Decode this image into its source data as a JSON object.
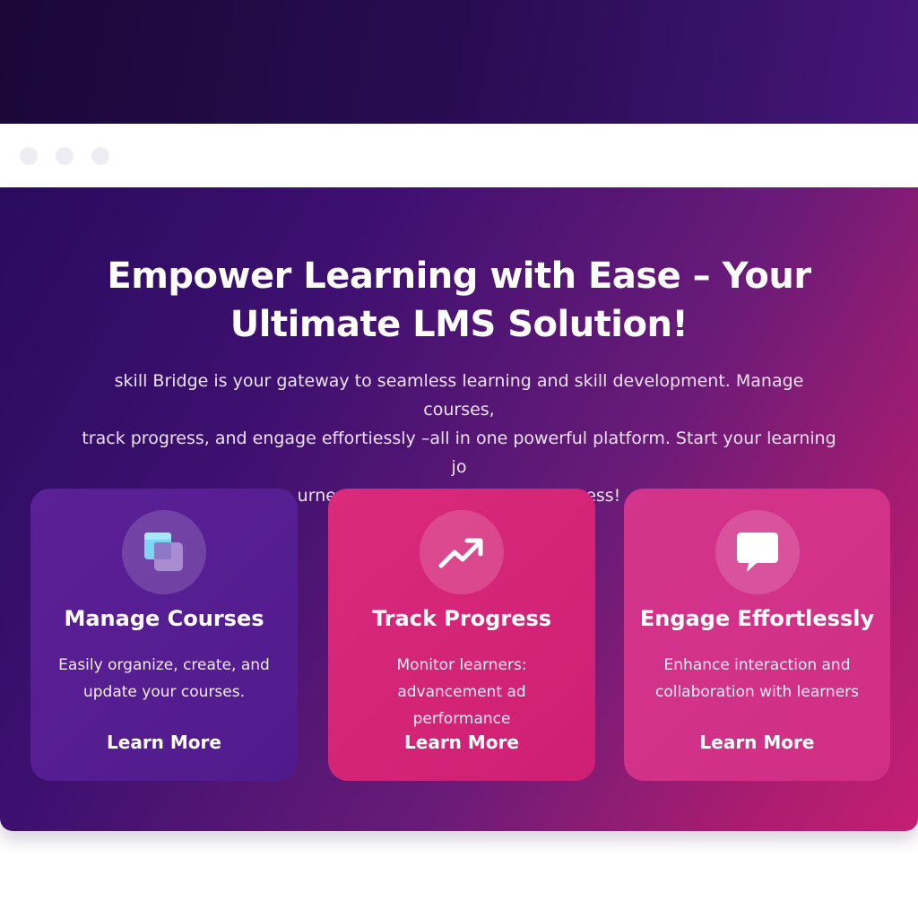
{
  "browser": {
    "window_controls": [
      "dot",
      "dot",
      "dot"
    ]
  },
  "hero": {
    "title_line1": "Empower Learning with Ease – Your",
    "title_line2": "Ultimate LMS Solution!",
    "description_line1": "skill Bridge is your gateway to seamless learning and skill development. Manage courses,",
    "description_line2": "track progress, and engage effortiessly –all in one powerful platform. Start your learning jo",
    "description_line3": "urney toxy bridge the gap to success!"
  },
  "cards": [
    {
      "icon": "course-windows-icon",
      "title": "Manage Courses",
      "desc_line1": "Easily organize, create, and",
      "desc_line2": "update your courses.",
      "link": "Learn More",
      "color": "#5a2196"
    },
    {
      "icon": "trending-up-icon",
      "title": "Track Progress",
      "desc_line1": "Monitor learners:",
      "desc_line2": "advancement ad performance",
      "link": "Learn More",
      "color": "#d6257a"
    },
    {
      "icon": "chat-bubble-icon",
      "title": "Engage Effortlessly",
      "desc_line1": "Enhance interaction and",
      "desc_line2": "collaboration with learners",
      "link": "Learn More",
      "color": "#d2358b"
    }
  ],
  "colors": {
    "top_band": "#1a0737",
    "hero_start": "#2a0b5e",
    "hero_end": "#c41f72",
    "icon_cyan": "#7ed6f2",
    "icon_lavender": "#b39ad8"
  }
}
